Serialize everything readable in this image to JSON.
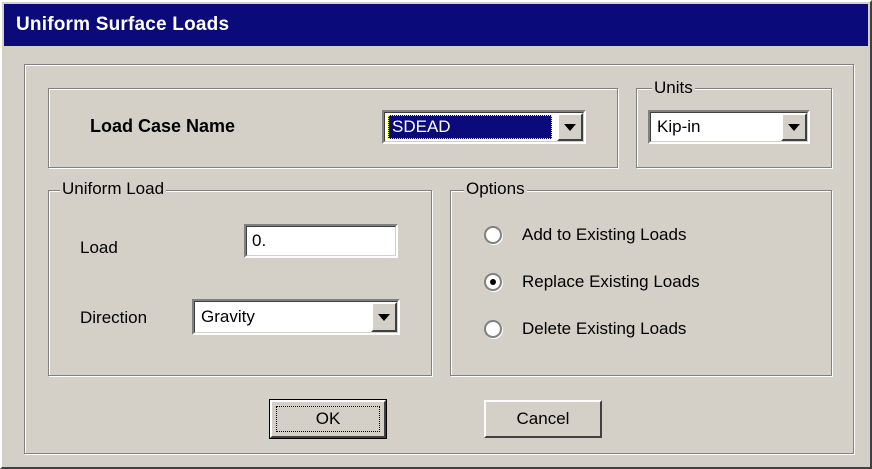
{
  "window": {
    "title": "Uniform Surface Loads"
  },
  "load_case": {
    "label": "Load Case Name",
    "selected": "SDEAD"
  },
  "units": {
    "group_label": "Units",
    "selected": "Kip-in"
  },
  "uniform_load": {
    "group_label": "Uniform Load",
    "load_label": "Load",
    "load_value": "0.",
    "direction_label": "Direction",
    "direction_selected": "Gravity"
  },
  "options": {
    "group_label": "Options",
    "items": [
      {
        "label": "Add to Existing Loads",
        "checked": false
      },
      {
        "label": "Replace Existing Loads",
        "checked": true
      },
      {
        "label": "Delete Existing Loads",
        "checked": false
      }
    ]
  },
  "buttons": {
    "ok": "OK",
    "cancel": "Cancel"
  },
  "colors": {
    "title_bar": "#0a0a7a",
    "face": "#d4d0c8",
    "selection": "#0a0a7a"
  }
}
